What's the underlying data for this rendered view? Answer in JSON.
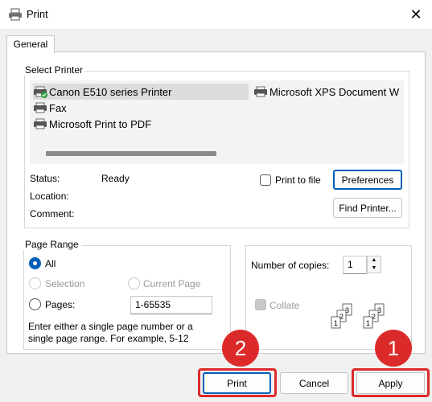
{
  "window": {
    "title": "Print"
  },
  "tab": {
    "label": "General"
  },
  "select_printer": {
    "title": "Select Printer",
    "printers": [
      {
        "name": "Canon E510 series Printer"
      },
      {
        "name": "Microsoft XPS Document W"
      },
      {
        "name": "Fax"
      },
      {
        "name": "Microsoft Print to PDF"
      }
    ],
    "status_label": "Status:",
    "status_value": "Ready",
    "location_label": "Location:",
    "comment_label": "Comment:",
    "print_to_file_label": "Print to file",
    "preferences_label": "Preferences",
    "find_printer_label": "Find Printer..."
  },
  "page_range": {
    "title": "Page Range",
    "all_label": "All",
    "selection_label": "Selection",
    "current_page_label": "Current Page",
    "pages_label": "Pages:",
    "pages_value": "1-65535",
    "hint_line1": "Enter either a single page number or a",
    "hint_line2": "single page range.  For example, 5-12"
  },
  "copies": {
    "number_label": "Number of copies:",
    "number_value": "1",
    "collate_label": "Collate"
  },
  "footer": {
    "print_label": "Print",
    "cancel_label": "Cancel",
    "apply_label": "Apply"
  },
  "annotations": {
    "badge_1": "1",
    "badge_2": "2",
    "color": "#dc2a2a"
  }
}
